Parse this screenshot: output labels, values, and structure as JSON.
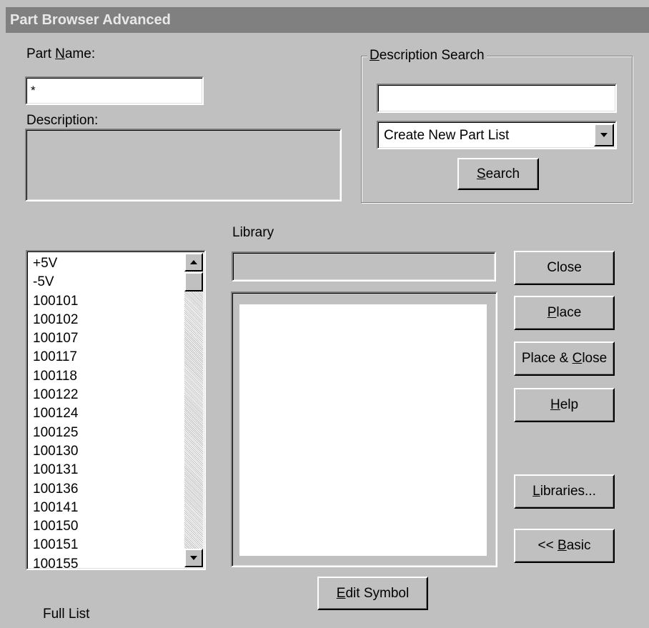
{
  "window": {
    "title": "Part Browser Advanced"
  },
  "part_name": {
    "label_pre": "Part ",
    "label_accel": "N",
    "label_post": "ame:",
    "value": "*"
  },
  "description": {
    "label": "Description:",
    "value": ""
  },
  "description_search": {
    "legend_accel": "D",
    "legend_post": "escription Search",
    "value": "",
    "mode_selected": "Create New Part List",
    "search_accel": "S",
    "search_post": "earch"
  },
  "library": {
    "label": "Library",
    "value": ""
  },
  "parts": [
    "+5V",
    "-5V",
    "100101",
    "100102",
    "100107",
    "100117",
    "100118",
    "100122",
    "100124",
    "100125",
    "100130",
    "100131",
    "100136",
    "100141",
    "100150",
    "100151",
    "100155"
  ],
  "buttons": {
    "close": "Close",
    "place_accel": "P",
    "place_post": "lace",
    "place_close_pre": "Place & ",
    "place_close_accel": "C",
    "place_close_post": "lose",
    "help_accel": "H",
    "help_post": "elp",
    "libraries_accel": "L",
    "libraries_post": "ibraries...",
    "basic_pre": "<< ",
    "basic_accel": "B",
    "basic_post": "asic",
    "edit_symbol_accel": "E",
    "edit_symbol_post": "dit Symbol"
  },
  "footer": {
    "full_list": "Full List"
  },
  "icons": {
    "scroll_up": "arrow-up-icon",
    "scroll_down": "arrow-down-icon",
    "dropdown": "arrow-down-icon"
  },
  "colors": {
    "face": "#c0c0c0",
    "titlebar": "#808080",
    "title_text": "#e8e8e8"
  }
}
